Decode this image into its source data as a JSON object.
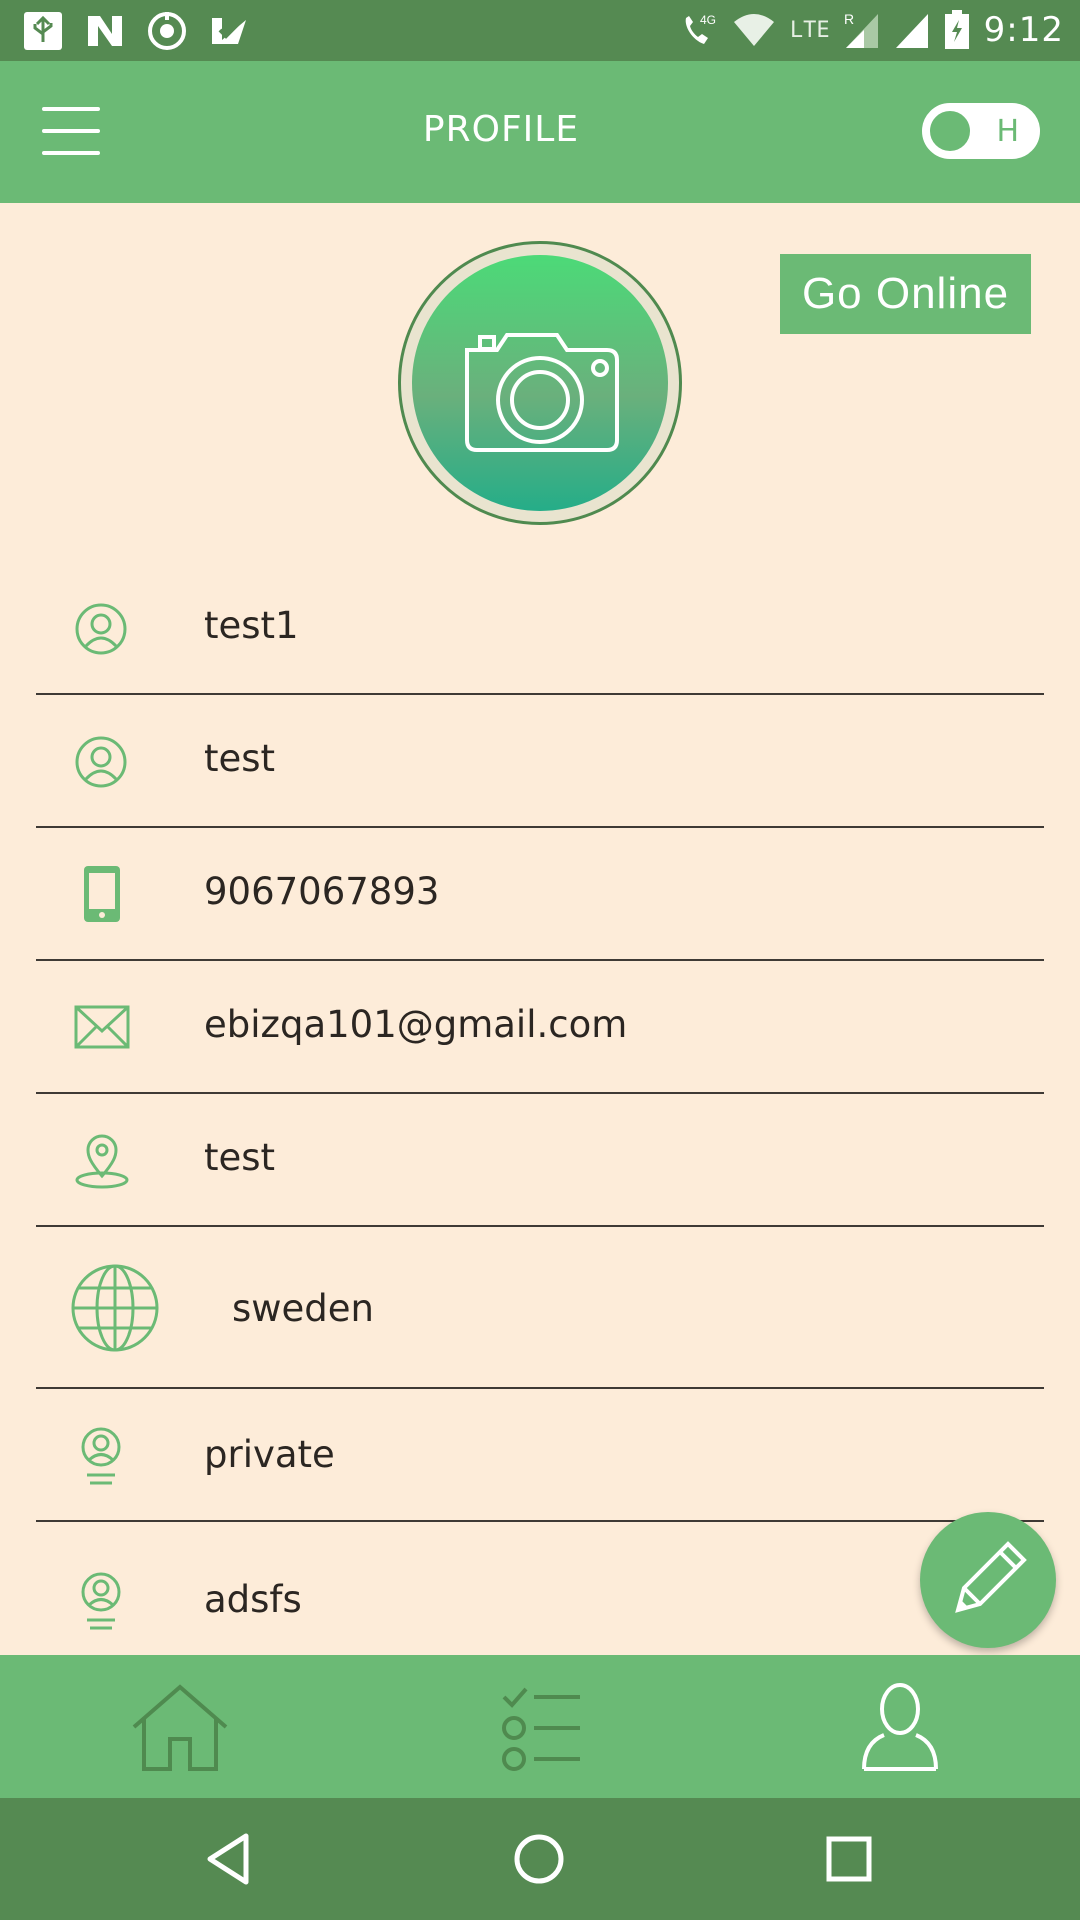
{
  "status_bar": {
    "time": "9:12",
    "network": "LTE",
    "roaming": "R",
    "call_label": "4G",
    "left_icons": [
      "usb-icon",
      "n-app-icon",
      "target-icon",
      "check-app-icon"
    ]
  },
  "header": {
    "title": "PROFILE",
    "toggle_label": "H",
    "menu_icon": "menu-icon"
  },
  "profile": {
    "go_online_label": "Go Online",
    "avatar_icon": "camera-icon"
  },
  "fields": [
    {
      "icon": "user-circle-icon",
      "value": "test1"
    },
    {
      "icon": "user-circle-icon",
      "value": "test"
    },
    {
      "icon": "phone-icon",
      "value": "9067067893"
    },
    {
      "icon": "mail-icon",
      "value": "ebizqa101@gmail.com"
    },
    {
      "icon": "location-pin-icon",
      "value": "test"
    },
    {
      "icon": "globe-icon",
      "value": "sweden"
    },
    {
      "icon": "user-lines-icon",
      "value": "private"
    },
    {
      "icon": "user-lines-icon",
      "value": "adsfs"
    }
  ],
  "fab_icon": "pencil-icon",
  "bottom_nav": [
    "home-icon",
    "checklist-icon",
    "person-icon"
  ],
  "system_nav": [
    "back-icon",
    "home-circle-icon",
    "recents-icon"
  ],
  "colors": {
    "primary": "#6bba75",
    "status_bar": "#558a52",
    "background": "#fdecd9",
    "text": "#2b2622",
    "icon_green": "#6bba75"
  }
}
